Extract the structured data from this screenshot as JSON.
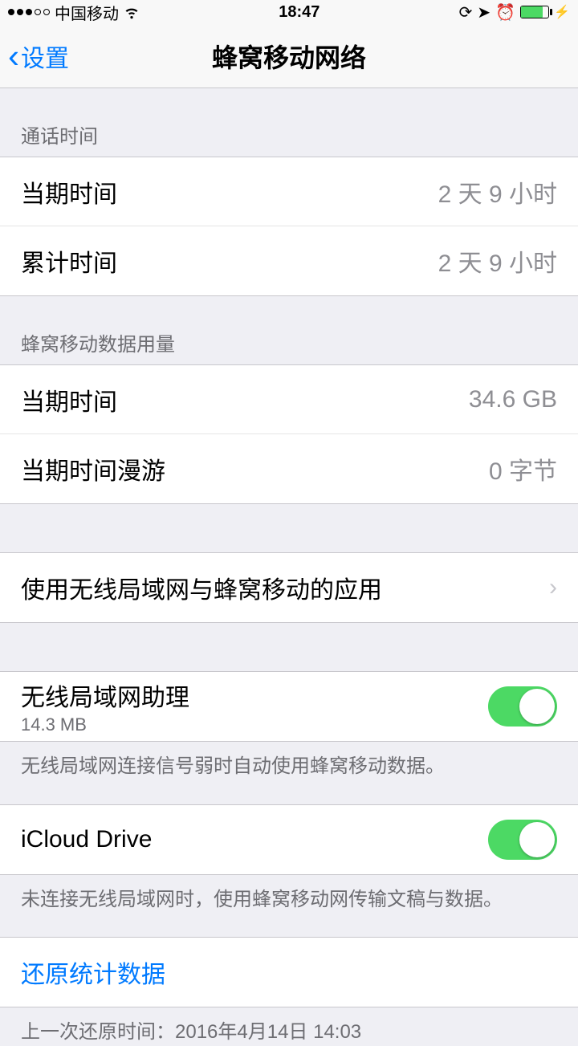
{
  "status": {
    "carrier": "中国移动",
    "time": "18:47"
  },
  "nav": {
    "back": "设置",
    "title": "蜂窝移动网络"
  },
  "section1": {
    "header": "通话时间",
    "row1_label": "当期时间",
    "row1_value": "2 天 9 小时",
    "row2_label": "累计时间",
    "row2_value": "2 天 9 小时"
  },
  "section2": {
    "header": "蜂窝移动数据用量",
    "row1_label": "当期时间",
    "row1_value": "34.6 GB",
    "row2_label": "当期时间漫游",
    "row2_value": "0 字节"
  },
  "section3": {
    "row1_label": "使用无线局域网与蜂窝移动的应用"
  },
  "section4": {
    "row1_label": "无线局域网助理",
    "row1_sub": "14.3 MB",
    "row1_on": true,
    "footer": "无线局域网连接信号弱时自动使用蜂窝移动数据。"
  },
  "section5": {
    "row1_label": "iCloud Drive",
    "row1_on": true,
    "footer": "未连接无线局域网时，使用蜂窝移动网传输文稿与数据。"
  },
  "section6": {
    "reset_label": "还原统计数据",
    "last_reset": "上一次还原时间：2016年4月14日 14:03"
  }
}
